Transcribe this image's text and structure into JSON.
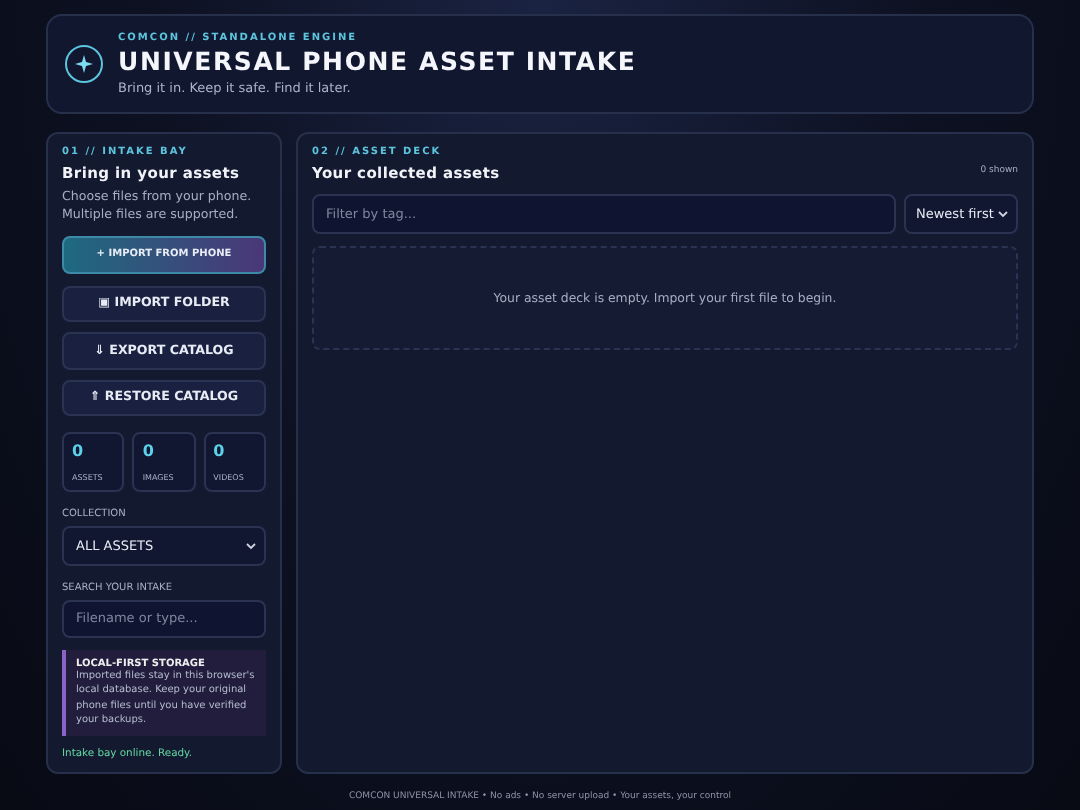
{
  "header": {
    "eyebrow": "COMCON // STANDALONE ENGINE",
    "title": "UNIVERSAL PHONE ASSET INTAKE",
    "tagline": "Bring it in. Keep it safe. Find it later."
  },
  "intake": {
    "eyebrow": "01 // INTAKE BAY",
    "title": "Bring in your assets",
    "description": "Choose files from your phone. Multiple files are supported.",
    "buttons": [
      {
        "label": "+ IMPORT FROM PHONE",
        "kind": "primary"
      },
      {
        "label": "▣ IMPORT FOLDER",
        "kind": "secondary"
      },
      {
        "label": "⇓ EXPORT CATALOG",
        "kind": "secondary"
      },
      {
        "label": "⇑ RESTORE CATALOG",
        "kind": "secondary"
      }
    ],
    "stats": [
      {
        "value": "0",
        "label": "ASSETS"
      },
      {
        "value": "0",
        "label": "IMAGES"
      },
      {
        "value": "0",
        "label": "VIDEOS"
      }
    ],
    "collection": {
      "label": "COLLECTION",
      "value": "ALL ASSETS"
    },
    "search": {
      "label": "SEARCH YOUR INTAKE",
      "placeholder": "Filename or type..."
    },
    "note": {
      "title": "LOCAL-FIRST STORAGE",
      "body": "Imported files stay in this browser's local database. Keep your original phone files until you have verified your backups."
    },
    "status": "Intake bay online. Ready."
  },
  "deck": {
    "eyebrow": "02 // ASSET DECK",
    "title": "Your collected assets",
    "count": "0 shown",
    "filter": {
      "placeholder": "Filter by tag..."
    },
    "sort": {
      "value": "Newest first"
    },
    "empty_message": "Your asset deck is empty. Import your first file to begin."
  },
  "footer": "COMCON UNIVERSAL INTAKE • No ads • No server upload • Your assets, your control"
}
